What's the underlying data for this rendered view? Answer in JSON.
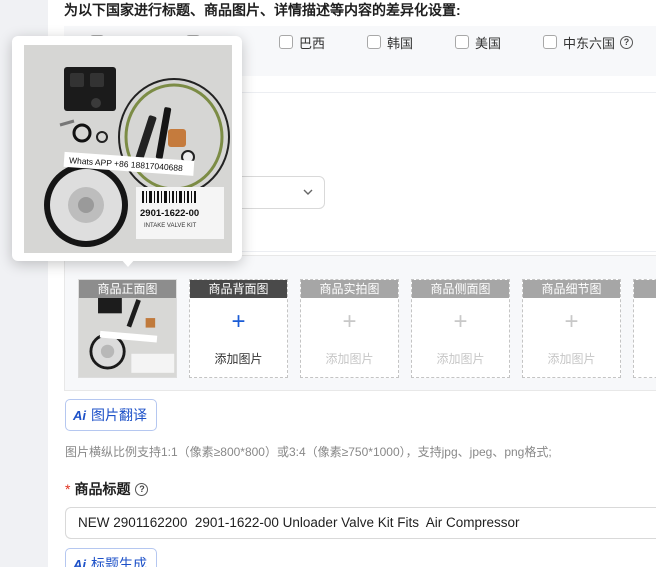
{
  "section": {
    "heading": "为以下国家进行标题、商品图片、详情描述等内容的差异化设置:"
  },
  "countries": [
    {
      "label": "巴西"
    },
    {
      "label": "韩国"
    },
    {
      "label": "美国"
    },
    {
      "label": "中东六国"
    }
  ],
  "preview": {
    "watermark": "Whats APP +86 18817040688",
    "part_number": "2901-1622-00",
    "kit_label": "INTAKE VALVE KIT"
  },
  "image_slots": [
    {
      "caption": "商品正面图",
      "state": "filled"
    },
    {
      "caption": "商品背面图",
      "add_label": "添加图片",
      "state": "active"
    },
    {
      "caption": "商品实拍图",
      "add_label": "添加图片",
      "state": "disabled"
    },
    {
      "caption": "商品侧面图",
      "add_label": "添加图片",
      "state": "disabled"
    },
    {
      "caption": "商品细节图",
      "add_label": "添加图片",
      "state": "disabled"
    }
  ],
  "buttons": {
    "image_translate": "图片翻译",
    "title_generate": "标题生成",
    "ai_badge": "Ai"
  },
  "hint": "图片横纵比例支持1:1（像素≥800*800）或3:4（像素≥750*1000），支持jpg、jpeg、png格式;",
  "title_field": {
    "required_mark": "*",
    "label": "商品标题",
    "value": "NEW 2901162200  2901-1622-00 Unloader Valve Kit Fits  Air Compressor"
  },
  "colors": {
    "accent": "#1d51c8",
    "required": "#e0301e"
  }
}
